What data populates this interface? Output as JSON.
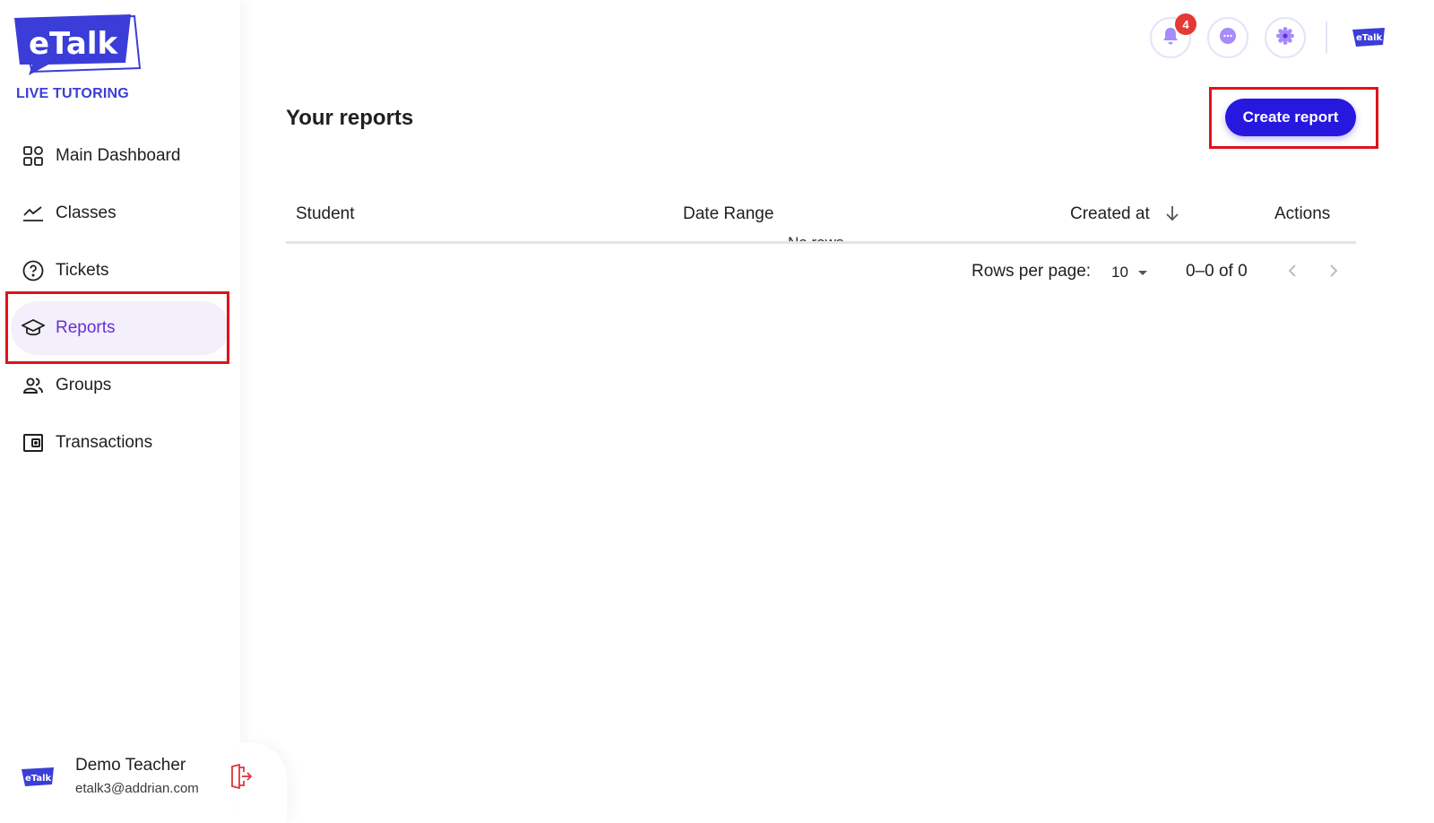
{
  "brand": {
    "logo_text": "eTalk",
    "subtitle": "LIVE TUTORING",
    "primary_color": "#2718e0",
    "logo_color": "#3b3dd8",
    "active_color": "#6a2fd6",
    "highlight_color": "#e0121b"
  },
  "sidebar": {
    "items": [
      {
        "label": "Main Dashboard",
        "icon": "dashboard-grid-icon",
        "active": false
      },
      {
        "label": "Classes",
        "icon": "chart-line-icon",
        "active": false
      },
      {
        "label": "Tickets",
        "icon": "help-circle-icon",
        "active": false
      },
      {
        "label": "Reports",
        "icon": "graduation-cap-icon",
        "active": true
      },
      {
        "label": "Groups",
        "icon": "people-icon",
        "active": false
      },
      {
        "label": "Transactions",
        "icon": "wallet-icon",
        "active": false
      }
    ]
  },
  "user": {
    "name": "Demo Teacher",
    "email": "etalk3@addrian.com",
    "avatar_text": "eTalk",
    "logout_icon": "logout-icon"
  },
  "topbar": {
    "notification_count": "4",
    "notification_icon": "bell-icon",
    "chat_icon": "chat-bubble-icon",
    "settings_icon": "gear-icon",
    "avatar_text": "eTalk"
  },
  "main": {
    "title": "Your reports",
    "create_button": "Create report",
    "table": {
      "columns": [
        "Student",
        "Date Range",
        "Created at",
        "Actions"
      ],
      "sorted_column": "Created at",
      "sort_direction": "descending",
      "empty_text": "No rows"
    },
    "pagination": {
      "rows_per_page_label": "Rows per page:",
      "rows_per_page_value": "10",
      "range_text": "0–0 of 0"
    }
  }
}
